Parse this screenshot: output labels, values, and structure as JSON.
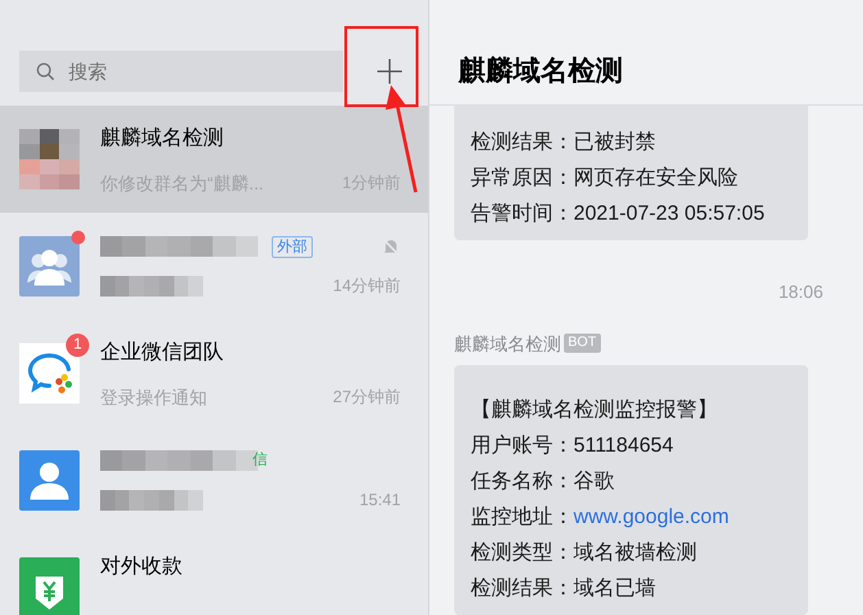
{
  "search": {
    "placeholder": "搜索"
  },
  "chats": [
    {
      "kind": "mosaic",
      "name": "麒麟域名检测",
      "preview": "你修改群名为“麒麟...",
      "time": "1分钟前",
      "selected": true
    },
    {
      "kind": "group",
      "redacted": true,
      "tag": "外部",
      "muted": true,
      "dot": true,
      "time": "14分钟前",
      "selected": false
    },
    {
      "kind": "wecom",
      "name": "企业微信团队",
      "badge": "1",
      "preview": "登录操作通知",
      "time": "27分钟前",
      "selected": false
    },
    {
      "kind": "person",
      "redacted": true,
      "tag_fragment": "信",
      "time": "15:41",
      "selected": false
    },
    {
      "kind": "payment",
      "name": "对外收款",
      "selected": false
    }
  ],
  "chat": {
    "title": "麒麟域名检测",
    "messages": [
      {
        "kind": "bubble",
        "lines": [
          {
            "label": "检测结果：",
            "value": "已被封禁"
          },
          {
            "label": "异常原因：",
            "value": "网页存在安全风险"
          },
          {
            "label": "告警时间：",
            "value": "2021-07-23 05:57:05"
          }
        ]
      },
      {
        "kind": "time",
        "text": "18:06"
      },
      {
        "kind": "bubble",
        "sender": "麒麟域名检测",
        "badge": "BOT",
        "lines": [
          {
            "value": "【麒麟域名检测监控报警】"
          },
          {
            "label": "用户账号：",
            "value": "511184654"
          },
          {
            "label": "任务名称：",
            "value": "谷歌"
          },
          {
            "label": "监控地址：",
            "value": "www.google.com",
            "link": true
          },
          {
            "label": "检测类型：",
            "value": "域名被墙检测"
          },
          {
            "label": "检测结果：",
            "value": "域名已墙"
          }
        ]
      }
    ]
  }
}
